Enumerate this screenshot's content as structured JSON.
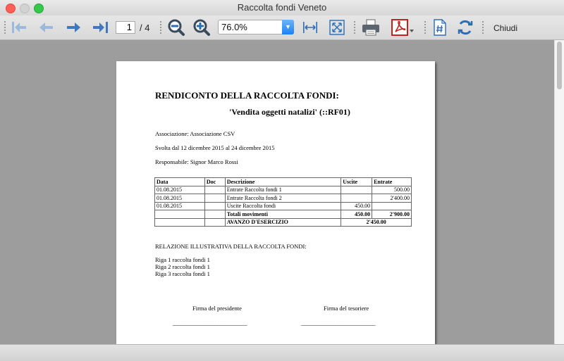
{
  "window": {
    "title": "Raccolta fondi Veneto"
  },
  "toolbar": {
    "buttons": {
      "first": "first-page-icon",
      "prev": "previous-page-icon",
      "next": "next-page-icon",
      "last": "last-page-icon",
      "zoom_out": "zoom-out-icon",
      "zoom_in": "zoom-in-icon",
      "fit_width": "fit-width-icon",
      "fit_page": "fit-page-icon",
      "print": "printer-icon",
      "pdf": "pdf-icon",
      "page_number_tool": "page-number-icon",
      "refresh": "refresh-icon"
    },
    "page_current": "1",
    "page_total": "/ 4",
    "zoom_value": "76.0%",
    "close_label": "Chiudi",
    "accent_color": "#1a82f7"
  },
  "document": {
    "title": "RENDICONTO DELLA RACCOLTA FONDI:",
    "subtitle": "'Vendita oggetti natalizi' (::RF01)",
    "association": "Associazione: Associazione CSV",
    "period": "Svolta dal 12 dicembre 2015 al 24 dicembre 2015",
    "responsible": "Responsabile: Signor Marco Rossi",
    "table": {
      "headers": [
        "Data",
        "Doc",
        "Descrizione",
        "Uscite",
        "Entrate"
      ],
      "rows": [
        [
          "01.08.2015",
          "",
          "Entrate Raccolta fondi 1",
          "",
          "500.00"
        ],
        [
          "01.08.2015",
          "",
          "Entrate Raccolta fondi 2",
          "",
          "2'400.00"
        ],
        [
          "01.08.2015",
          "",
          "Uscite Raccolta fondi",
          "450.00",
          ""
        ]
      ],
      "totals": {
        "label": "Totali movimenti",
        "uscite": "450.00",
        "entrate": "2'900.00"
      },
      "result": {
        "label": "AVANZO D'ESERCIZIO",
        "value": "2'450.00"
      }
    },
    "report_heading": "RELAZIONE ILLUSTRATIVA DELLA RACCOLTA FONDI:",
    "report_lines": [
      "Riga 1 raccolta fondi 1",
      "Riga 2 raccolta fondi 1",
      "Riga 3 raccolta fondi 1"
    ],
    "signatures": {
      "president": "Firma del presidente",
      "treasurer": "Firma del tesoriere",
      "line": "______________________________"
    }
  }
}
